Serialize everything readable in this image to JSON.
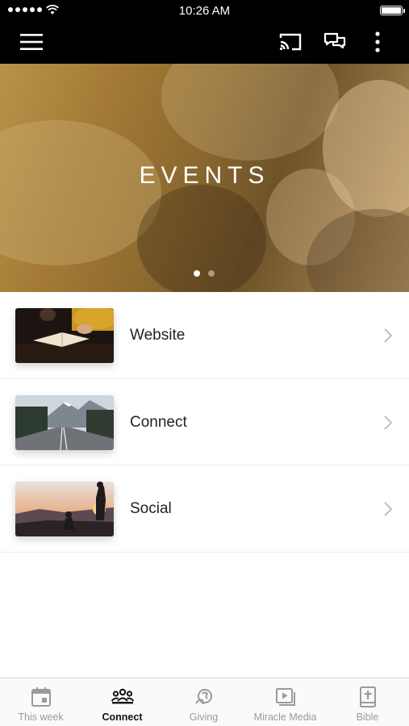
{
  "status_bar": {
    "time": "10:26 AM"
  },
  "app_bar": {
    "icons": [
      "menu-icon",
      "cast-icon",
      "chat-icon",
      "more-vertical-icon"
    ]
  },
  "hero": {
    "title": "EVENTS",
    "pages": 2,
    "active_page": 1
  },
  "list": {
    "items": [
      {
        "label": "Website",
        "thumbnail": "open-bible-on-table"
      },
      {
        "label": "Connect",
        "thumbnail": "mountain-road"
      },
      {
        "label": "Social",
        "thumbnail": "people-at-sunset"
      }
    ]
  },
  "tabs": [
    {
      "label": "This week",
      "icon": "calendar-icon",
      "active": false
    },
    {
      "label": "Connect",
      "icon": "people-group-icon",
      "active": true
    },
    {
      "label": "Giving",
      "icon": "giving-icon",
      "active": false
    },
    {
      "label": "Miracle Media",
      "icon": "media-play-icon",
      "active": false
    },
    {
      "label": "Bible",
      "icon": "bible-icon",
      "active": false
    }
  ],
  "colors": {
    "bar_background": "#000000",
    "tab_active": "#111111",
    "tab_inactive": "#9a9a9a",
    "hero_tint": "#a27a35"
  }
}
